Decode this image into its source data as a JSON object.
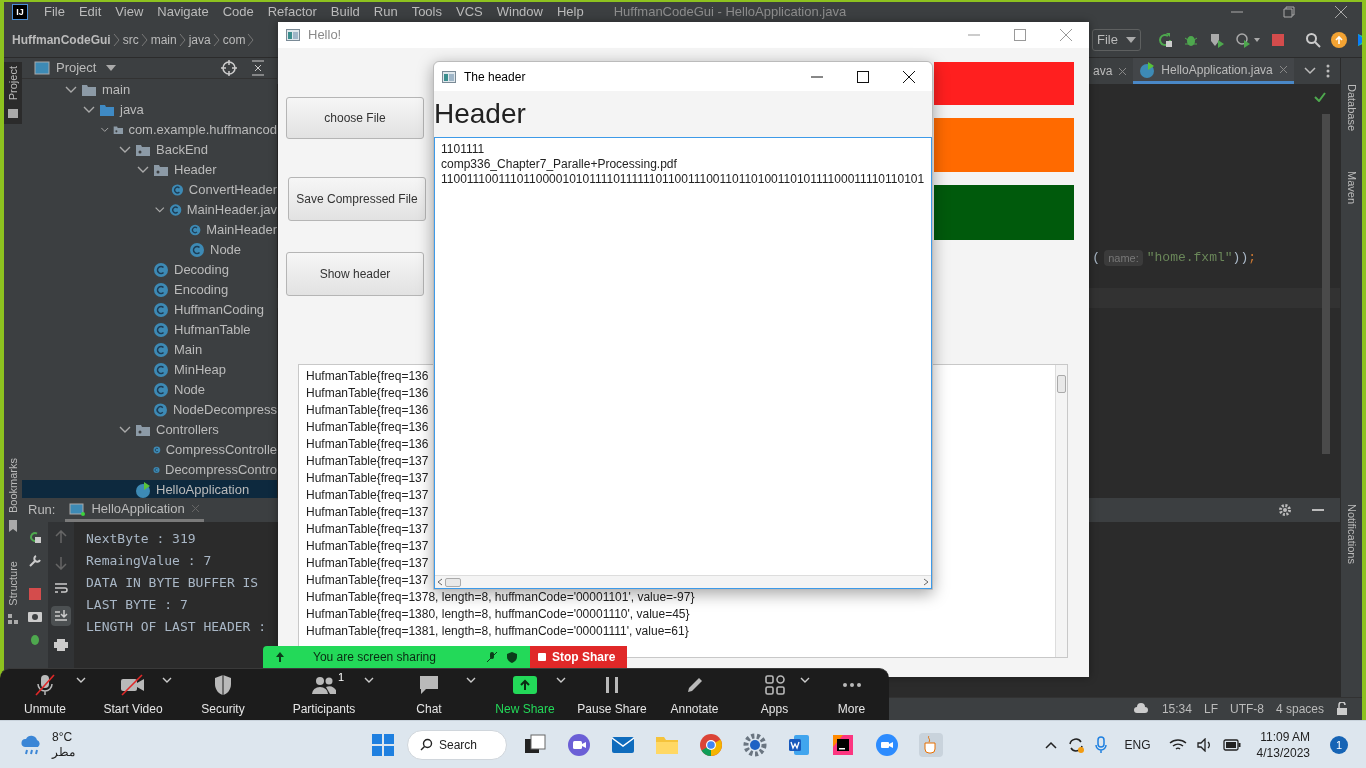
{
  "ide": {
    "logo": "IJ",
    "menu": [
      "File",
      "Edit",
      "View",
      "Navigate",
      "Code",
      "Refactor",
      "Build",
      "Run",
      "Tools",
      "VCS",
      "Window",
      "Help"
    ],
    "title": "HuffmanCodeGui - HelloApplication.java",
    "breadcrumbs": [
      "HuffmanCodeGui",
      "src",
      "main",
      "java",
      "com"
    ],
    "run_config": "File",
    "left_tabs": [
      {
        "label": "Project",
        "selected": true
      },
      {
        "label": "Bookmarks",
        "selected": false
      },
      {
        "label": "Structure",
        "selected": false
      }
    ],
    "right_tabs": [
      "Database",
      "Maven",
      "Notifications"
    ],
    "project_panel": {
      "title": "Project",
      "tree": [
        {
          "label": "main",
          "kind": "folder",
          "expanded": true,
          "selected": false,
          "children": [
            {
              "label": "java",
              "kind": "source",
              "expanded": true,
              "selected": false,
              "children": [
                {
                  "label": "com.example.huffmancod",
                  "kind": "package",
                  "expanded": true,
                  "selected": false,
                  "children": [
                    {
                      "label": "BackEnd",
                      "kind": "package",
                      "expanded": true,
                      "selected": false,
                      "children": [
                        {
                          "label": "Header",
                          "kind": "package",
                          "expanded": true,
                          "selected": false,
                          "children": [
                            {
                              "label": "ConvertHeader",
                              "kind": "class",
                              "selected": false
                            },
                            {
                              "label": "MainHeader.jav",
                              "kind": "class",
                              "expanded": true,
                              "selected": false,
                              "children": [
                                {
                                  "label": "MainHeader",
                                  "kind": "class",
                                  "selected": false
                                },
                                {
                                  "label": "Node",
                                  "kind": "class",
                                  "selected": false
                                }
                              ]
                            }
                          ]
                        },
                        {
                          "label": "Decoding",
                          "kind": "class",
                          "selected": false
                        },
                        {
                          "label": "Encoding",
                          "kind": "class",
                          "selected": false
                        },
                        {
                          "label": "HuffmanCoding",
                          "kind": "class",
                          "selected": false
                        },
                        {
                          "label": "HufmanTable",
                          "kind": "class",
                          "selected": false
                        },
                        {
                          "label": "Main",
                          "kind": "class",
                          "selected": false
                        },
                        {
                          "label": "MinHeap",
                          "kind": "class",
                          "selected": false
                        },
                        {
                          "label": "Node",
                          "kind": "class",
                          "selected": false
                        },
                        {
                          "label": "NodeDecompress",
                          "kind": "class",
                          "selected": false
                        }
                      ]
                    },
                    {
                      "label": "Controllers",
                      "kind": "package",
                      "expanded": true,
                      "selected": false,
                      "children": [
                        {
                          "label": "CompressControlle",
                          "kind": "class",
                          "selected": false
                        },
                        {
                          "label": "DecompressContro",
                          "kind": "class",
                          "selected": false
                        }
                      ]
                    },
                    {
                      "label": "HelloApplication",
                      "kind": "runnable",
                      "selected": true
                    }
                  ]
                }
              ]
            }
          ]
        }
      ]
    },
    "editor_tabs": [
      {
        "label": "ava",
        "selected": false
      },
      {
        "label": "HelloApplication.java",
        "selected": true
      }
    ],
    "code_line": {
      "open": "(",
      "hint": "name:",
      "string": "\"home.fxml\"",
      "close": "))",
      "end": ";"
    },
    "run_panel": {
      "label": "Run:",
      "tab": "HelloApplication",
      "lines": [
        "NextByte : 319",
        "RemaingValue : 7",
        "DATA IN BYTE BUFFER IS",
        "LAST BYTE : 7",
        "LENGTH OF LAST HEADER :"
      ]
    },
    "status_bar": [
      "15:34",
      "LF",
      "UTF-8",
      "4 spaces"
    ]
  },
  "hello_window": {
    "title": "Hello!",
    "buttons": [
      "choose File",
      "Save Compressed File",
      "Show header"
    ],
    "color_bars": [
      {
        "color": "#ff1f1f"
      },
      {
        "color": "#ff6a00"
      },
      {
        "color": "#005a0c"
      }
    ],
    "list_lines": [
      "HufmanTable{freq=136",
      "HufmanTable{freq=136",
      "HufmanTable{freq=136",
      "HufmanTable{freq=136",
      "HufmanTable{freq=136",
      "HufmanTable{freq=137",
      "HufmanTable{freq=137",
      "HufmanTable{freq=137",
      "HufmanTable{freq=137",
      "HufmanTable{freq=137",
      "HufmanTable{freq=137",
      "HufmanTable{freq=137",
      "HufmanTable{freq=137",
      "HufmanTable{freq=1378, length=8, huffmanCode='00001101', value=-97}",
      "HufmanTable{freq=1380, length=8, huffmanCode='00001110', value=45}",
      "HufmanTable{freq=1381, length=8, huffmanCode='00001111', value=61}"
    ]
  },
  "header_dialog": {
    "title": "The header",
    "heading": "Header",
    "lines": [
      "1101111",
      "comp336_Chapter7_Paralle+Processing.pdf",
      "1100111001110110000101011110111111011001110011011010011010111100011110110101"
    ]
  },
  "zoom": {
    "sharing_text": "You are screen sharing",
    "stop": "Stop Share",
    "controls": [
      {
        "label": "Unmute",
        "kind": "mic",
        "menu": true
      },
      {
        "label": "Start Video",
        "kind": "video",
        "menu": true
      },
      {
        "label": "Security",
        "kind": "shield",
        "menu": false
      },
      {
        "label": "Participants",
        "kind": "people",
        "count": "1",
        "menu": true
      },
      {
        "label": "Chat",
        "kind": "chat",
        "menu": true
      },
      {
        "label": "New Share",
        "kind": "share",
        "menu": true
      },
      {
        "label": "Pause Share",
        "kind": "pause",
        "menu": false
      },
      {
        "label": "Annotate",
        "kind": "pen",
        "menu": false
      },
      {
        "label": "Apps",
        "kind": "apps",
        "menu": true
      },
      {
        "label": "More",
        "kind": "more",
        "menu": false
      }
    ]
  },
  "taskbar": {
    "temperature": "8°C",
    "weather": "مطر",
    "search": "Search",
    "language": "ENG",
    "time": "11:09 AM",
    "date": "4/13/2023",
    "notifications": "1"
  }
}
